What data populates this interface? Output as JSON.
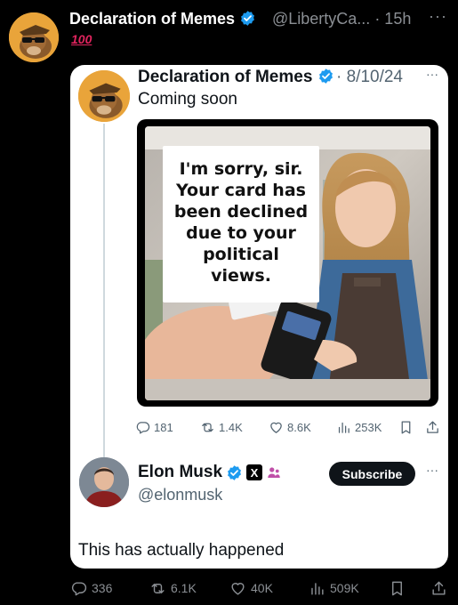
{
  "outer_post": {
    "author_name": "Declaration of Memes",
    "handle_time": "@LibertyCa... · 15h",
    "emoji_text": "100",
    "actions": {
      "replies": "336",
      "reposts": "6.1K",
      "likes": "40K",
      "views": "509K"
    }
  },
  "quoted_post": {
    "author_name": "Declaration of Memes",
    "date": "· 8/10/24",
    "text": "Coming soon",
    "image_caption": "I'm sorry, sir.\nYour card has\nbeen declined\ndue to your\npolitical\nviews.",
    "actions": {
      "replies": "181",
      "reposts": "1.4K",
      "likes": "8.6K",
      "views": "253K"
    }
  },
  "reply": {
    "author_name": "Elon Musk",
    "handle": "@elonmusk",
    "x_badge": "X",
    "subscribe_label": "Subscribe",
    "text": "This has actually happened"
  },
  "icons": {
    "verified": "verified-badge-icon",
    "reply": "reply-icon",
    "repost": "repost-icon",
    "like": "heart-icon",
    "views": "views-icon",
    "bookmark": "bookmark-icon",
    "share": "share-icon",
    "more": "more-icon"
  },
  "colors": {
    "verified": "#1d9bf0",
    "emoji": "#e0245e",
    "subscribe_bg": "#0f1419"
  }
}
